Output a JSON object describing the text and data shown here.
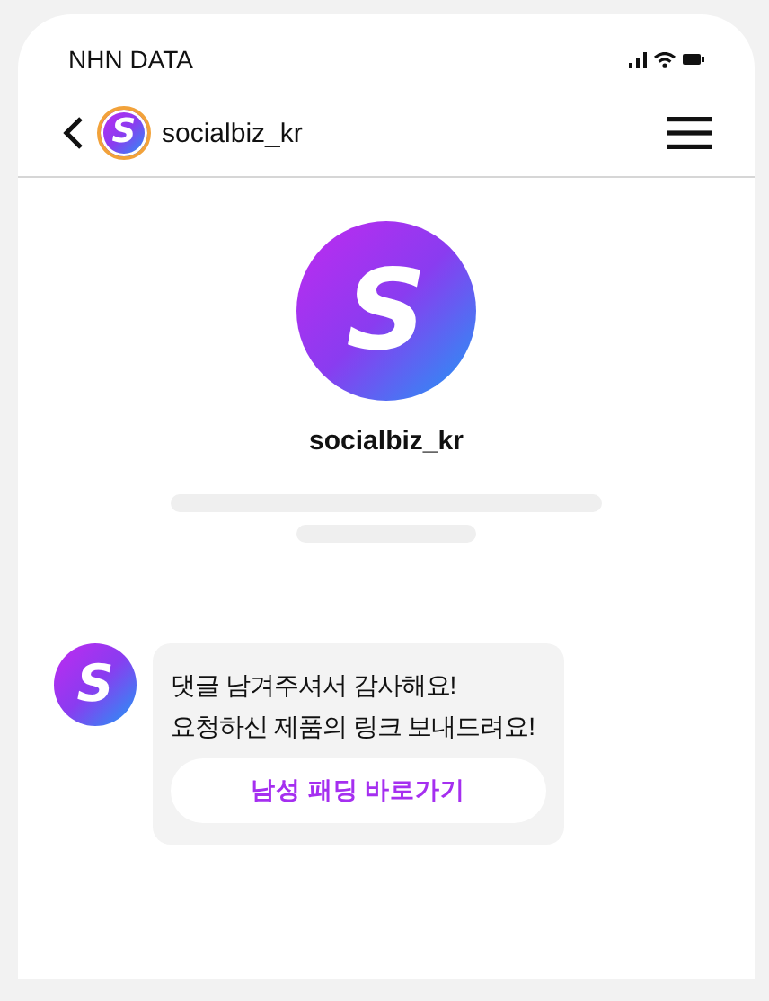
{
  "status_bar": {
    "carrier": "NHN DATA"
  },
  "header": {
    "logo_letter": "S",
    "account": "socialbiz_kr"
  },
  "profile": {
    "logo_letter": "S",
    "name": "socialbiz_kr"
  },
  "message": {
    "logo_letter": "S",
    "lines": [
      "댓글 남겨주셔서 감사해요!",
      "요청하신 제품의 링크 보내드려요!"
    ],
    "link_button": "남성 패딩 바로가기"
  }
}
